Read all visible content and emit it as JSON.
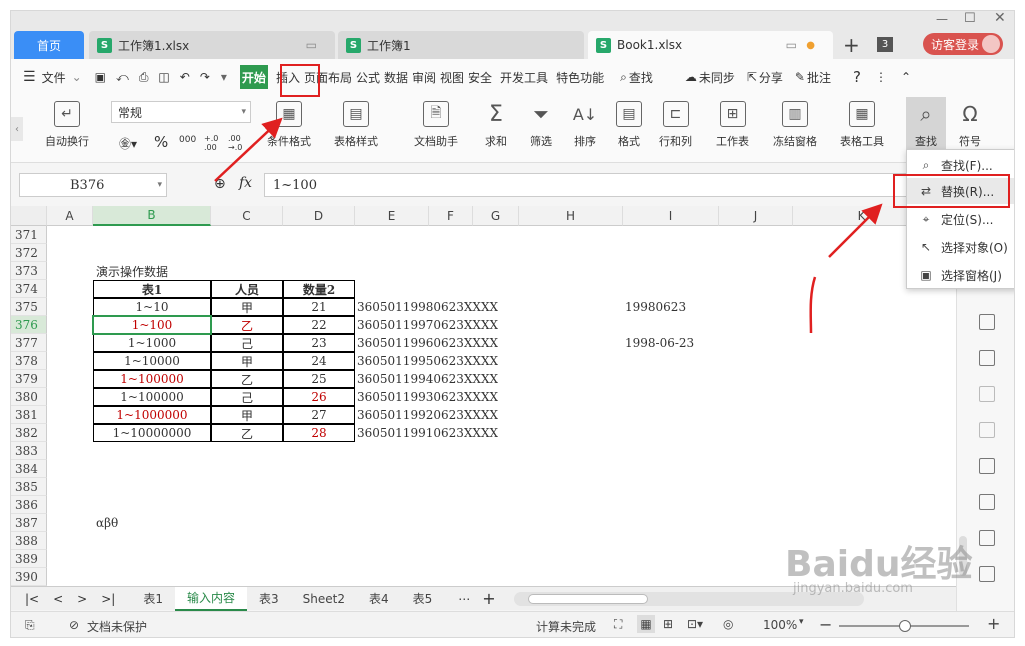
{
  "tabs": {
    "home": "首页",
    "doc1": "工作簿1.xlsx",
    "doc2": "工作簿1",
    "doc3": "Book1.xlsx",
    "count": "3",
    "login": "访客登录"
  },
  "menu": {
    "file": "文件",
    "items": [
      "开始",
      "插入",
      "页面布局",
      "公式",
      "数据",
      "审阅",
      "视图",
      "安全",
      "开发工具",
      "特色功能"
    ],
    "search": "查找",
    "sync": "未同步",
    "share": "分享",
    "comment": "批注"
  },
  "ribbon": {
    "autowrap": "自动换行",
    "format_select": "常规",
    "percent": "%",
    "thousand": "000",
    "inc_dec": "+.0 .00",
    "dec_dec": ".00 →.0",
    "cond_format": "条件格式",
    "table_style": "表格样式",
    "doc_helper": "文档助手",
    "sum": "求和",
    "filter": "筛选",
    "sort": "排序",
    "format": "格式",
    "rowcol": "行和列",
    "worksheet": "工作表",
    "freeze": "冻结窗格",
    "table_tools": "表格工具",
    "find": "查找",
    "symbol": "符号"
  },
  "formula": {
    "namebox": "B376",
    "fx": "fx",
    "content": "1~100"
  },
  "columns": [
    "A",
    "B",
    "C",
    "D",
    "E",
    "F",
    "G",
    "H",
    "I",
    "J",
    "K"
  ],
  "rows": [
    "371",
    "372",
    "373",
    "374",
    "375",
    "376",
    "377",
    "378",
    "379",
    "380",
    "381",
    "382",
    "383",
    "384",
    "385",
    "386",
    "387",
    "388",
    "389",
    "390"
  ],
  "sheet": {
    "title": "演示操作数据",
    "headers": [
      "表1",
      "人员",
      "数量2"
    ],
    "data": [
      {
        "b": "1~10",
        "c": "甲",
        "d": "21",
        "e": "36050119980623XXXX",
        "i": "19980623"
      },
      {
        "b": "1~100",
        "c": "乙",
        "d": "22",
        "e": "36050119970623XXXX",
        "i": ""
      },
      {
        "b": "1~1000",
        "c": "己",
        "d": "23",
        "e": "36050119960623XXXX",
        "i": "1998-06-23"
      },
      {
        "b": "1~10000",
        "c": "甲",
        "d": "24",
        "e": "36050119950623XXXX",
        "i": ""
      },
      {
        "b": "1~100000",
        "c": "乙",
        "d": "25",
        "e": "36050119940623XXXX",
        "i": ""
      },
      {
        "b": "1~100000",
        "c": "己",
        "d": "26",
        "e": "36050119930623XXXX",
        "i": ""
      },
      {
        "b": "1~1000000",
        "c": "甲",
        "d": "27",
        "e": "36050119920623XXXX",
        "i": ""
      },
      {
        "b": "1~10000000",
        "c": "乙",
        "d": "28",
        "e": "36050119910623XXXX",
        "i": ""
      }
    ],
    "greek": "αβθ"
  },
  "sheet_tabs": [
    "表1",
    "输入内容",
    "表3",
    "Sheet2",
    "表4",
    "表5"
  ],
  "active_sheet": "输入内容",
  "dropdown": [
    "查找(F)...",
    "替换(R)...",
    "定位(S)...",
    "选择对象(O)",
    "选择窗格(J)"
  ],
  "status": {
    "protect": "文档未保护",
    "calc": "计算未完成",
    "zoom": "100%"
  },
  "watermark": {
    "logo": "Baidu经验",
    "url": "jingyan.baidu.com"
  }
}
